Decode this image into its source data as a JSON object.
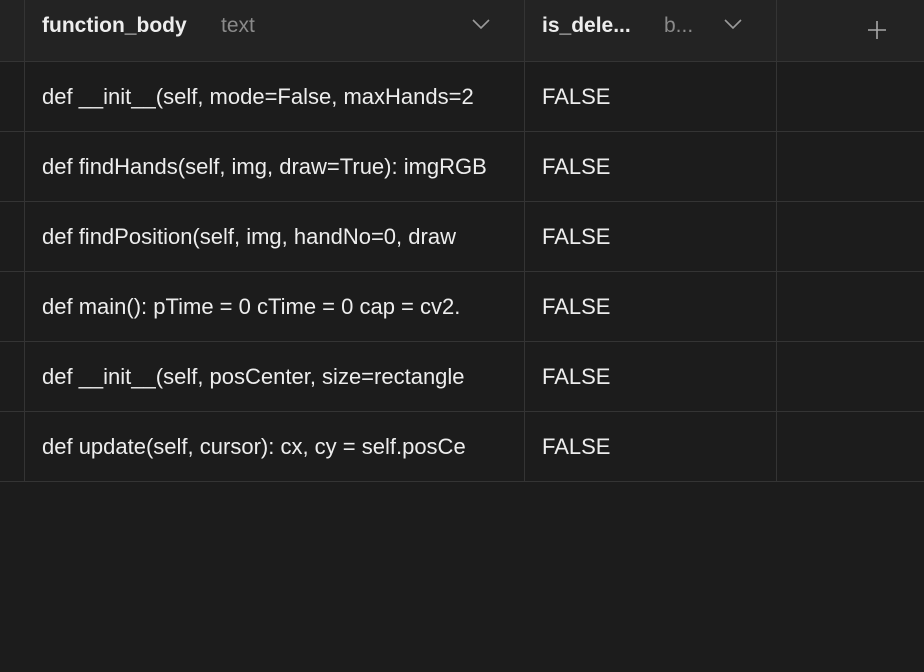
{
  "columns": {
    "function_body": {
      "name": "function_body",
      "type": "text"
    },
    "is_deleted": {
      "name": "is_dele...",
      "type": "b..."
    },
    "add_column_icon": "plus-icon",
    "dropdown_icon": "chevron-down-icon"
  },
  "rows": [
    {
      "function_body": "def __init__(self, mode=False, maxHands=2",
      "is_deleted": "FALSE"
    },
    {
      "function_body": "def findHands(self, img, draw=True): imgRGB",
      "is_deleted": "FALSE"
    },
    {
      "function_body": "def findPosition(self, img, handNo=0, draw",
      "is_deleted": "FALSE"
    },
    {
      "function_body": "def main(): pTime = 0 cTime = 0 cap = cv2.",
      "is_deleted": "FALSE"
    },
    {
      "function_body": "def __init__(self, posCenter, size=rectangle",
      "is_deleted": "FALSE"
    },
    {
      "function_body": "def update(self, cursor): cx, cy = self.posCe",
      "is_deleted": "FALSE"
    }
  ],
  "colors": {
    "background": "#1c1c1c",
    "header": "#232323",
    "border": "#343434",
    "text": "#ededed",
    "muted": "#8a8a8a"
  }
}
